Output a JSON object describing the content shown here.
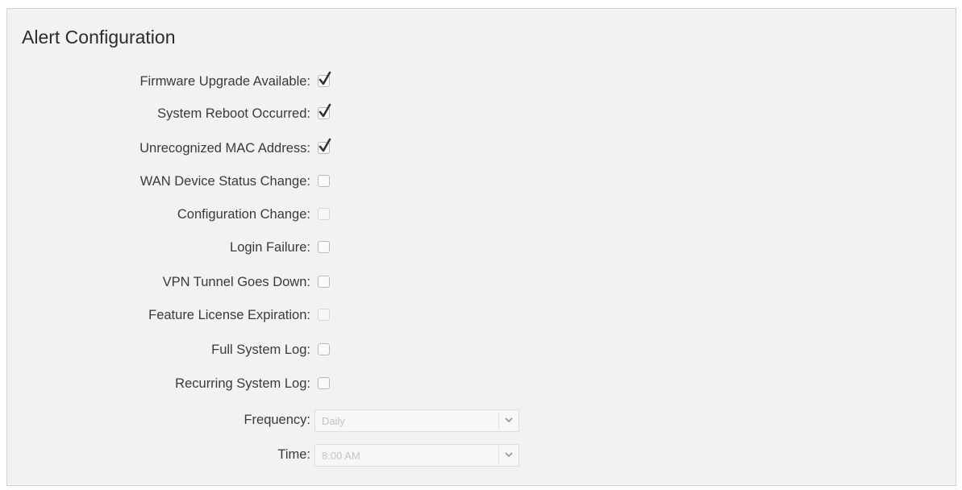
{
  "alert_config": {
    "title": "Alert Configuration",
    "options": [
      {
        "label": "Firmware Upgrade Available:",
        "checked": true,
        "enabled": true
      },
      {
        "label": "System Reboot Occurred:",
        "checked": true,
        "enabled": true
      },
      {
        "label": "Unrecognized MAC Address:",
        "checked": true,
        "enabled": true
      },
      {
        "label": "WAN Device Status Change:",
        "checked": false,
        "enabled": true
      },
      {
        "label": "Configuration Change:",
        "checked": false,
        "enabled": false
      },
      {
        "label": "Login Failure:",
        "checked": false,
        "enabled": true
      },
      {
        "label": "VPN Tunnel Goes Down:",
        "checked": false,
        "enabled": true
      },
      {
        "label": "Feature License Expiration:",
        "checked": false,
        "enabled": false
      },
      {
        "label": "Full System Log:",
        "checked": false,
        "enabled": true
      },
      {
        "label": "Recurring System Log:",
        "checked": false,
        "enabled": true
      }
    ],
    "frequency": {
      "label": "Frequency:",
      "value": "Daily",
      "enabled": false
    },
    "time": {
      "label": "Time:",
      "value": "8:00 AM",
      "enabled": false
    }
  },
  "icons": {
    "checkbox_check": "check-icon",
    "dropdown": "chevron-down-icon"
  },
  "colors": {
    "panel_bg": "#f2f2f2",
    "panel_border": "#d2d2d2",
    "text": "#3a3a3a"
  }
}
